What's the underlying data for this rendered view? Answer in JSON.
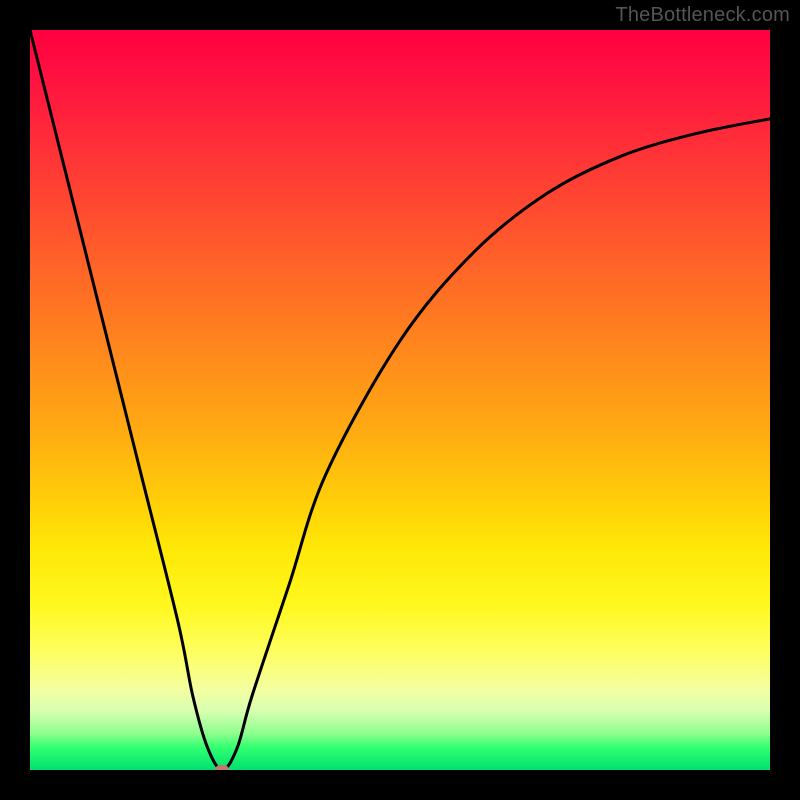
{
  "watermark": "TheBottleneck.com",
  "chart_data": {
    "type": "line",
    "title": "",
    "xlabel": "",
    "ylabel": "",
    "xlim": [
      0,
      100
    ],
    "ylim": [
      0,
      100
    ],
    "grid": false,
    "legend": false,
    "series": [
      {
        "name": "bottleneck-curve",
        "x": [
          0,
          5,
          10,
          15,
          20,
          22,
          24,
          26,
          28,
          30,
          35,
          40,
          50,
          60,
          70,
          80,
          90,
          100
        ],
        "y": [
          100,
          80,
          60,
          40,
          20,
          10,
          3,
          0,
          3,
          10,
          25,
          40,
          58,
          70,
          78,
          83,
          86,
          88
        ]
      }
    ],
    "marker": {
      "name": "optimal-point",
      "x": 26,
      "y": 0
    }
  },
  "colors": {
    "background": "#000000",
    "curve": "#000000",
    "marker": "#c47a6a",
    "watermark": "#555555"
  }
}
